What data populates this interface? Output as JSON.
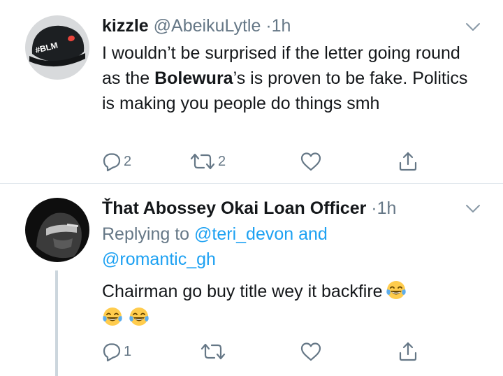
{
  "tweets": [
    {
      "name": "kizzle",
      "handle": "@AbeikuLytle",
      "dot": "·",
      "time": "1h",
      "avatar_text": "#BLM",
      "text_before": "I wouldn’t be surprised if the letter going round as the ",
      "text_bold": "Bolewura",
      "text_after": "’s is proven to be fake. Politics is making you people do things smh",
      "reply_count": "2",
      "retweet_count": "2",
      "like_count": "",
      "icons": [
        "reply-icon",
        "retweet-icon",
        "like-icon",
        "share-icon",
        "chevron-down-icon"
      ]
    },
    {
      "name": "Ťhat Abossey Okai Loan Officer",
      "dot": "·",
      "time": "1h",
      "replying_to_label": "Replying to ",
      "replying_to_user1": "@teri_devon",
      "replying_and": " and",
      "replying_to_user2": "@romantic_gh",
      "text": "Chairman go buy title wey it backfire",
      "reply_count": "1",
      "retweet_count": "",
      "like_count": "",
      "emojis": [
        "face-with-tears-of-joy",
        "face-with-tears-of-joy",
        "face-with-tears-of-joy"
      ]
    }
  ],
  "colors": {
    "text": "#14171a",
    "secondary": "#657786",
    "link": "#1da1f2",
    "divider": "#e1e8ed",
    "thread_line": "#ccd6dd"
  }
}
